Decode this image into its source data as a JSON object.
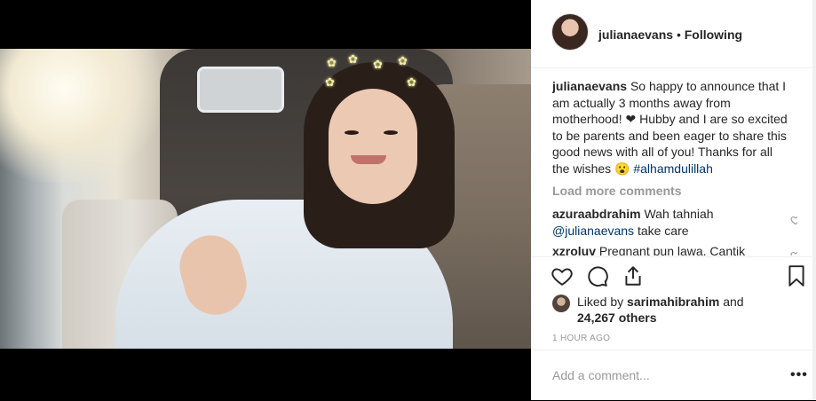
{
  "post": {
    "username": "julianaevans",
    "separator": "•",
    "follow_status": "Following"
  },
  "caption": {
    "username": "julianaevans",
    "text": "So happy to announce that I am actually 3 months away from motherhood! ❤ Hubby and I are so excited to be parents and been eager to share this good news with all of you! Thanks for all the wishes 😮",
    "hashtag": "#alhamdulillah"
  },
  "load_more": "Load more comments",
  "comments": [
    {
      "username": "azuraabdrahim",
      "text_prefix": "Wah tahniah ",
      "mention": "@julianaevans",
      "text_suffix": " take care"
    },
    {
      "username": "xzroluv",
      "text_prefix": "Pregnant pun lawa. Cantik",
      "mention": "",
      "text_suffix": ""
    }
  ],
  "likes": {
    "prefix": "Liked by ",
    "liker": "sarimahibrahim",
    "middle": " and ",
    "count_text": "24,267 others"
  },
  "timestamp": "1 HOUR AGO",
  "comment_box": {
    "placeholder": "Add a comment...",
    "more": "•••"
  },
  "icons": [
    "heart-icon",
    "comment-icon",
    "share-icon",
    "bookmark-icon"
  ]
}
